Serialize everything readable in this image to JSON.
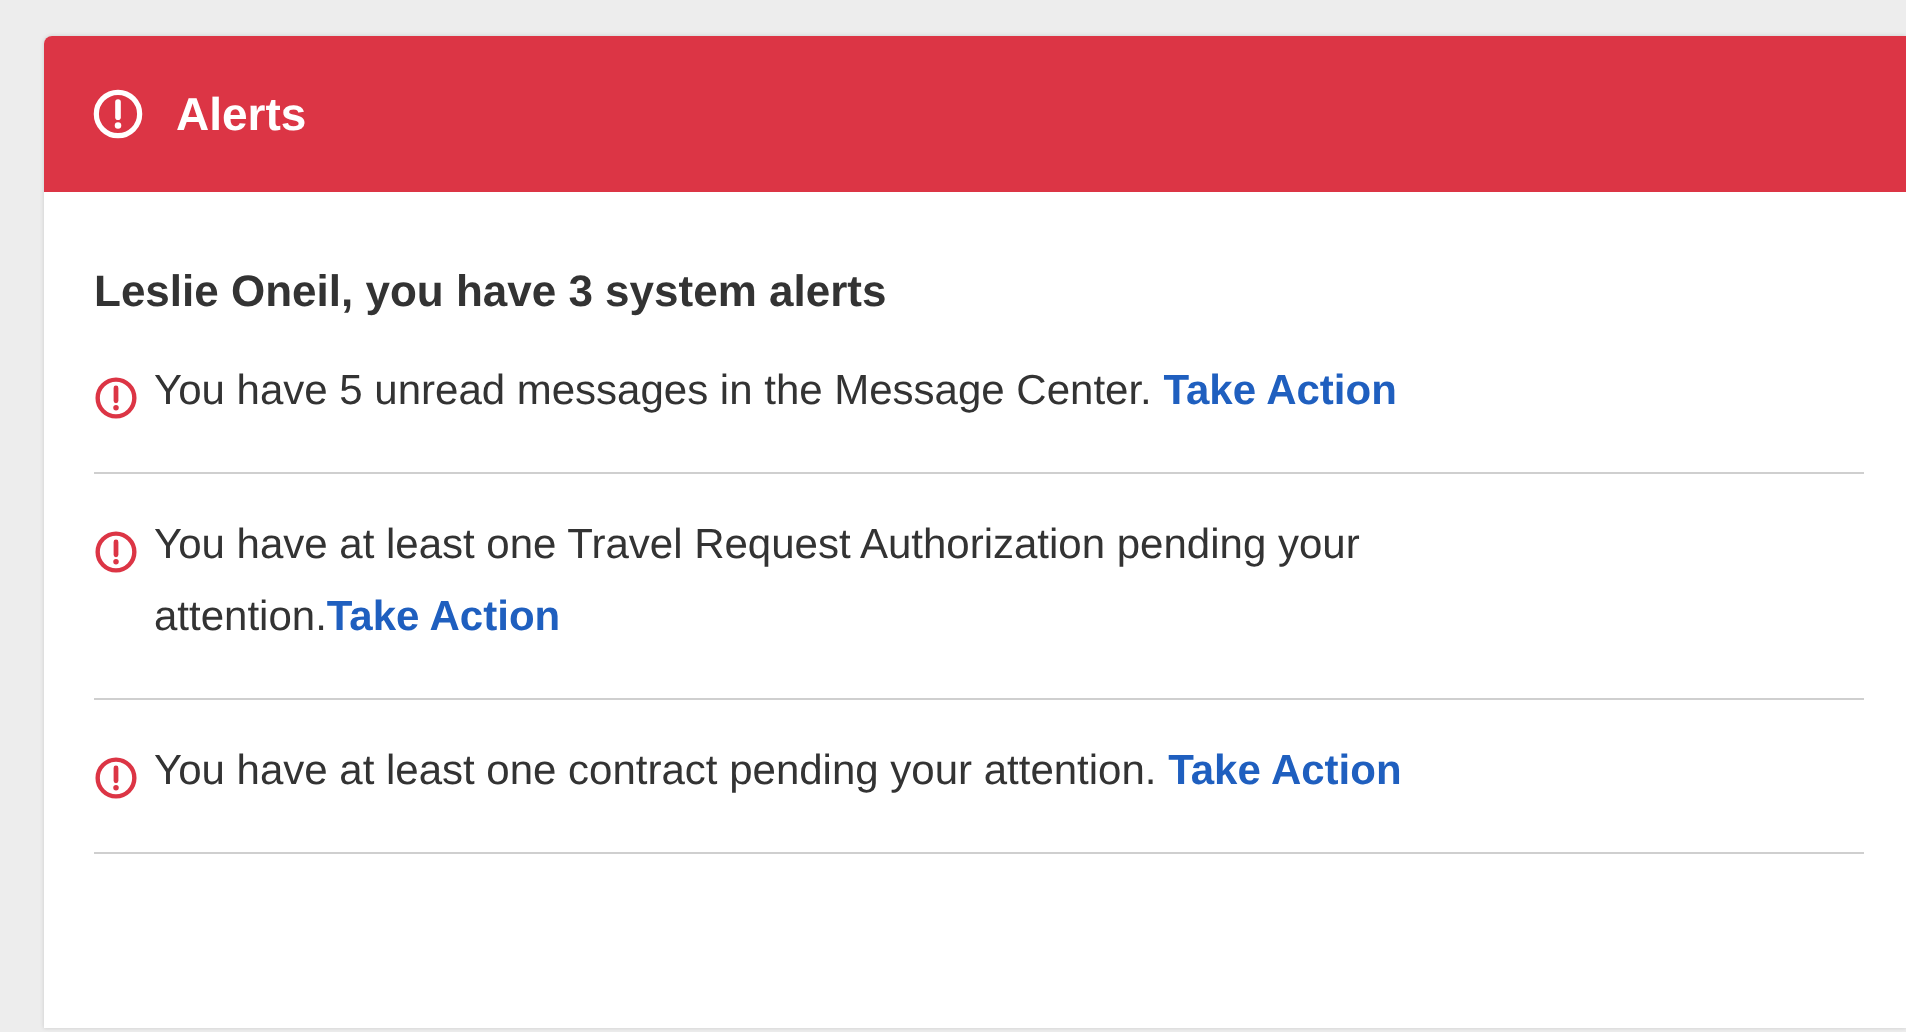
{
  "panel": {
    "title": "Alerts"
  },
  "summary": "Leslie Oneil, you have 3 system alerts",
  "alerts": [
    {
      "text": "You have 5 unread messages in the Message Center. ",
      "link": "Take Action"
    },
    {
      "text": "You have at least one Travel Request Authorization pending your attention.",
      "link": "Take Action"
    },
    {
      "text": "You have at least one contract pending your attention. ",
      "link": "Take Action"
    }
  ]
}
